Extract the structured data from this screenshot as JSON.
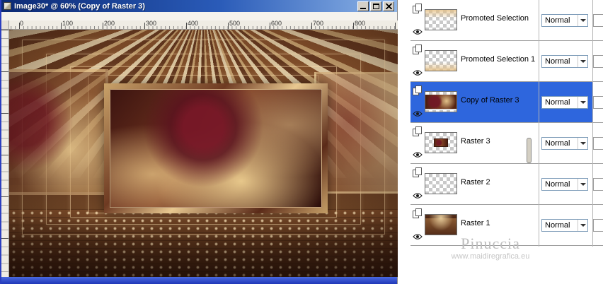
{
  "window": {
    "title": "Image30* @ 60% (Copy of Raster 3)"
  },
  "ruler": {
    "h_labels": [
      "0",
      "100",
      "200",
      "300",
      "400",
      "500",
      "600",
      "700",
      "800"
    ]
  },
  "layers_panel": {
    "rows": [
      {
        "name": "Promoted Selection",
        "blend": "Normal",
        "selected": false,
        "visible": true
      },
      {
        "name": "Promoted Selection 1",
        "blend": "Normal",
        "selected": false,
        "visible": true
      },
      {
        "name": "Copy of Raster 3",
        "blend": "Normal",
        "selected": true,
        "visible": true
      },
      {
        "name": "Raster 3",
        "blend": "Normal",
        "selected": false,
        "visible": true
      },
      {
        "name": "Raster 2",
        "blend": "Normal",
        "selected": false,
        "visible": true
      },
      {
        "name": "Raster 1",
        "blend": "Normal",
        "selected": false,
        "visible": true
      }
    ],
    "selected_row": "Copy of Raster 3"
  },
  "watermark": {
    "name": "Pinuccia",
    "url": "www.maidiregrafica.eu"
  },
  "colors": {
    "titlebar_start": "#0b2a75",
    "titlebar_end": "#8fb6e8",
    "selection_blue": "#2e66dd",
    "window_bottom_bar": "#2038b8"
  }
}
